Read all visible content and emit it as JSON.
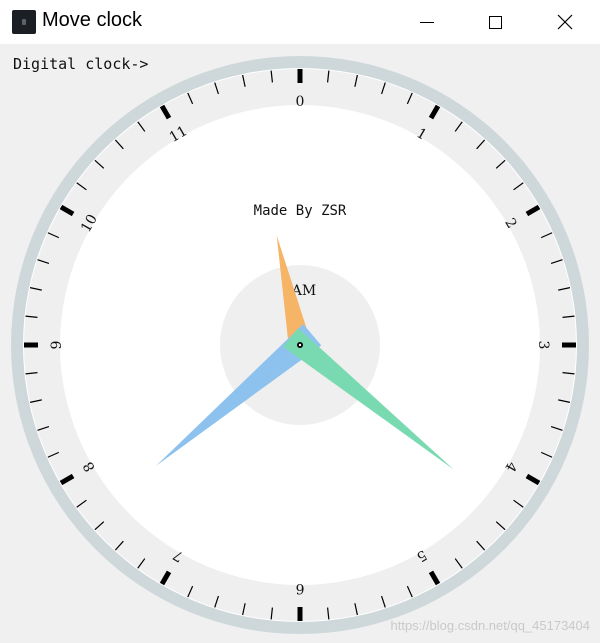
{
  "window": {
    "title": "Move clock",
    "controls": {
      "minimize": "minimize",
      "maximize": "maximize",
      "close": "close"
    }
  },
  "content": {
    "digital_link": "Digital clock->",
    "credit": "Made  By  ZSR",
    "period": "AM",
    "watermark": "https://blog.csdn.net/qq_45173404"
  },
  "clock": {
    "numerals": [
      "0",
      "1",
      "2",
      "3",
      "4",
      "5",
      "6",
      "7",
      "8",
      "9",
      "10",
      "11"
    ],
    "hands": {
      "hour": {
        "angle_deg": -12,
        "color": "#f5b466"
      },
      "minute": {
        "angle_deg": 129,
        "color": "#79dab1"
      },
      "second": {
        "angle_deg": 230,
        "color": "#8ec2ee"
      }
    },
    "colors": {
      "bezel": "#ced8db",
      "face": "#ffffff",
      "center_disc": "#efefef",
      "ticks": "#000000"
    }
  }
}
